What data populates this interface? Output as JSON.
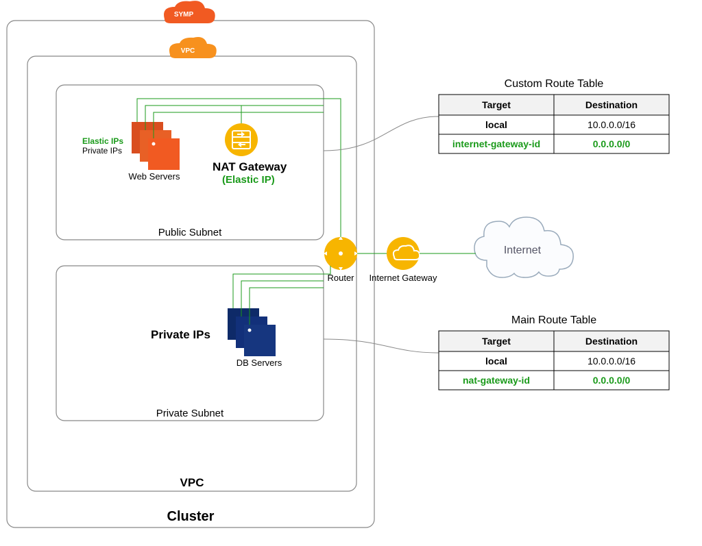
{
  "cluster_label": "Cluster",
  "vpc_label": "VPC",
  "vpc_badge": "VPC",
  "outer_badge": "SYMP",
  "public_subnet_label": "Public Subnet",
  "private_subnet_label": "Private Subnet",
  "web_servers_label": "Web Servers",
  "db_servers_label": "DB Servers",
  "elastic_ips_label": "Elastic IPs",
  "private_ips_label": "Private IPs",
  "private_ips_bold": "Private IPs",
  "nat_gateway_label": "NAT Gateway",
  "nat_gateway_eip": "(Elastic IP)",
  "router_label": "Router",
  "igw_label": "Internet Gateway",
  "internet_label": "Internet",
  "custom_table": {
    "title": "Custom Route Table",
    "headers": {
      "target": "Target",
      "destination": "Destination"
    },
    "rows": [
      {
        "target": "local",
        "destination": "10.0.0.0/16",
        "cls": "black"
      },
      {
        "target": "internet-gateway-id",
        "destination": "0.0.0.0/0",
        "cls": "green"
      }
    ]
  },
  "main_table": {
    "title": "Main Route Table",
    "headers": {
      "target": "Target",
      "destination": "Destination"
    },
    "rows": [
      {
        "target": "local",
        "destination": "10.0.0.0/16",
        "cls": "black"
      },
      {
        "target": "nat-gateway-id",
        "destination": "0.0.0.0/0",
        "cls": "green"
      }
    ]
  },
  "colors": {
    "orange": "#f15a22",
    "orange_light": "#f7911e",
    "yellow": "#f7b500",
    "navy": "#16367f",
    "green": "#1a9a1a"
  }
}
